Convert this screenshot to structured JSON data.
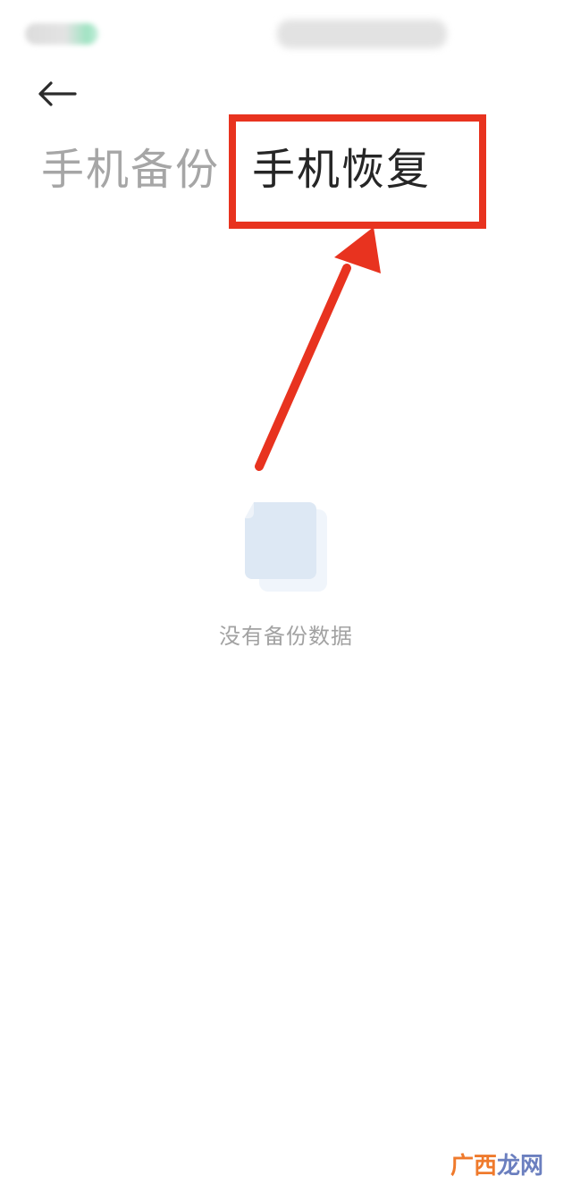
{
  "header": {
    "back_label": "←"
  },
  "tabs": [
    {
      "label": "手机备份",
      "active": false
    },
    {
      "label": "手机恢复",
      "active": true
    }
  ],
  "empty_state": {
    "icon": "document-icon",
    "message": "没有备份数据"
  },
  "annotation": {
    "color": "#e8331f"
  },
  "watermark": {
    "part1": "广西",
    "part2": "龙网"
  }
}
